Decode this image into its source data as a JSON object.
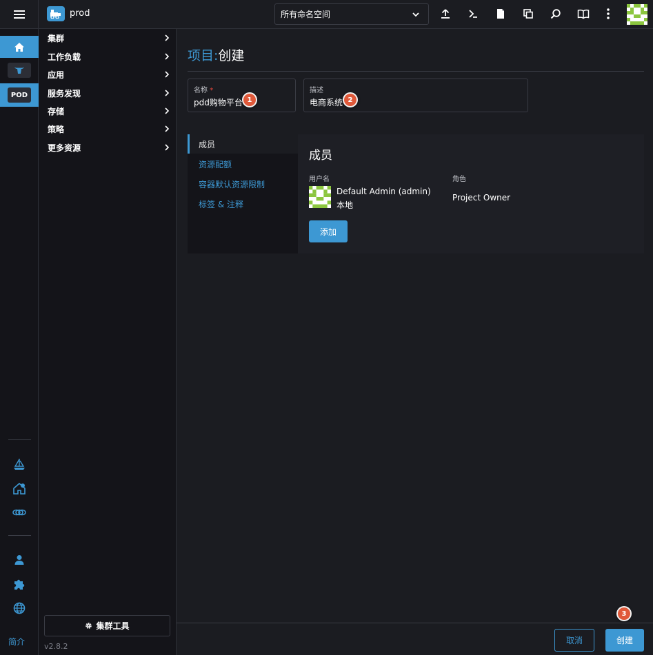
{
  "header": {
    "cluster_name": "prod",
    "namespace_select": "所有命名空间",
    "icons": [
      "menu-icon",
      "cluster-icon",
      "upload-icon",
      "terminal-icon",
      "file-icon",
      "copy-icon",
      "search-icon",
      "book-icon",
      "more-icon",
      "user-avatar"
    ]
  },
  "rail": {
    "pod_label": "POD",
    "about_label": "简介"
  },
  "sidenav": {
    "items": [
      {
        "label": "集群"
      },
      {
        "label": "工作负载"
      },
      {
        "label": "应用"
      },
      {
        "label": "服务发现"
      },
      {
        "label": "存储"
      },
      {
        "label": "策略"
      },
      {
        "label": "更多资源"
      }
    ],
    "tools_label": "集群工具",
    "version": "v2.8.2"
  },
  "page": {
    "title_crumb": "项目:",
    "title_action": "创建"
  },
  "form": {
    "name_label": "名称",
    "name_required": "*",
    "name_value": "pdd购物平台",
    "desc_label": "描述",
    "desc_value": "电商系统"
  },
  "markers": [
    "1",
    "2",
    "3"
  ],
  "tabs": [
    {
      "label": "成员"
    },
    {
      "label": "资源配额"
    },
    {
      "label": "容器默认资源限制"
    },
    {
      "label": "标签 & 注释"
    }
  ],
  "members": {
    "title": "成员",
    "col_username": "用户名",
    "col_role": "角色",
    "rows": [
      {
        "name": "Default Admin (admin)",
        "sub": "本地",
        "role": "Project Owner"
      }
    ],
    "add_label": "添加"
  },
  "footer": {
    "cancel_label": "取消",
    "create_label": "创建"
  },
  "colors": {
    "accent": "#3d98d3",
    "background": "#1b1c21",
    "marker": "#e0593a",
    "avatar_green": "#8cc63f"
  }
}
